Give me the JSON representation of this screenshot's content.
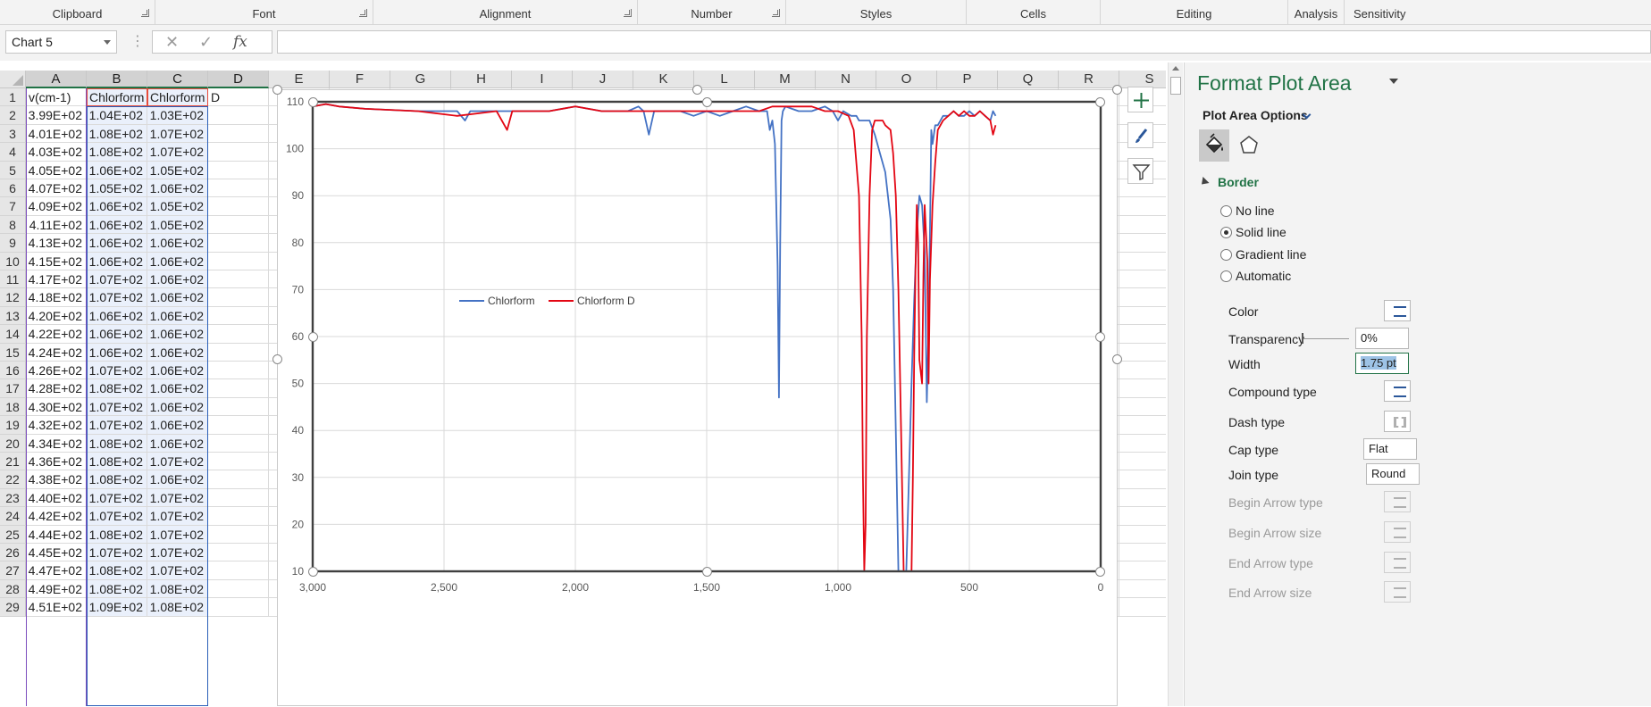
{
  "ribbon": {
    "groups": [
      "Clipboard",
      "Font",
      "Alignment",
      "Number",
      "Styles",
      "Cells",
      "Editing",
      "Analysis",
      "Sensitivity"
    ]
  },
  "formula_bar": {
    "name_box": "Chart 5",
    "cancel_icon": "✕",
    "enter_icon": "✓",
    "fx_label": "fx",
    "formula": ""
  },
  "grid": {
    "columns": [
      "A",
      "B",
      "C",
      "D",
      "E",
      "F",
      "G",
      "H",
      "I",
      "J",
      "K",
      "L",
      "M",
      "N",
      "O",
      "P",
      "Q",
      "R",
      "S"
    ],
    "rows": [
      {
        "n": "1",
        "a": "v(cm-1)",
        "b": "Chlorform",
        "c": "Chlorform",
        "d": "D"
      },
      {
        "n": "2",
        "a": "3.99E+02",
        "b": "1.04E+02",
        "c": "1.03E+02"
      },
      {
        "n": "3",
        "a": "4.01E+02",
        "b": "1.08E+02",
        "c": "1.07E+02"
      },
      {
        "n": "4",
        "a": "4.03E+02",
        "b": "1.08E+02",
        "c": "1.07E+02"
      },
      {
        "n": "5",
        "a": "4.05E+02",
        "b": "1.06E+02",
        "c": "1.05E+02"
      },
      {
        "n": "6",
        "a": "4.07E+02",
        "b": "1.05E+02",
        "c": "1.06E+02"
      },
      {
        "n": "7",
        "a": "4.09E+02",
        "b": "1.06E+02",
        "c": "1.05E+02"
      },
      {
        "n": "8",
        "a": "4.11E+02",
        "b": "1.06E+02",
        "c": "1.05E+02"
      },
      {
        "n": "9",
        "a": "4.13E+02",
        "b": "1.06E+02",
        "c": "1.06E+02"
      },
      {
        "n": "10",
        "a": "4.15E+02",
        "b": "1.06E+02",
        "c": "1.06E+02"
      },
      {
        "n": "11",
        "a": "4.17E+02",
        "b": "1.07E+02",
        "c": "1.06E+02"
      },
      {
        "n": "12",
        "a": "4.18E+02",
        "b": "1.07E+02",
        "c": "1.06E+02"
      },
      {
        "n": "13",
        "a": "4.20E+02",
        "b": "1.06E+02",
        "c": "1.06E+02"
      },
      {
        "n": "14",
        "a": "4.22E+02",
        "b": "1.06E+02",
        "c": "1.06E+02"
      },
      {
        "n": "15",
        "a": "4.24E+02",
        "b": "1.06E+02",
        "c": "1.06E+02"
      },
      {
        "n": "16",
        "a": "4.26E+02",
        "b": "1.07E+02",
        "c": "1.06E+02"
      },
      {
        "n": "17",
        "a": "4.28E+02",
        "b": "1.08E+02",
        "c": "1.06E+02"
      },
      {
        "n": "18",
        "a": "4.30E+02",
        "b": "1.07E+02",
        "c": "1.06E+02"
      },
      {
        "n": "19",
        "a": "4.32E+02",
        "b": "1.07E+02",
        "c": "1.06E+02"
      },
      {
        "n": "20",
        "a": "4.34E+02",
        "b": "1.08E+02",
        "c": "1.06E+02"
      },
      {
        "n": "21",
        "a": "4.36E+02",
        "b": "1.08E+02",
        "c": "1.07E+02"
      },
      {
        "n": "22",
        "a": "4.38E+02",
        "b": "1.08E+02",
        "c": "1.06E+02"
      },
      {
        "n": "23",
        "a": "4.40E+02",
        "b": "1.07E+02",
        "c": "1.07E+02"
      },
      {
        "n": "24",
        "a": "4.42E+02",
        "b": "1.07E+02",
        "c": "1.07E+02"
      },
      {
        "n": "25",
        "a": "4.44E+02",
        "b": "1.08E+02",
        "c": "1.07E+02"
      },
      {
        "n": "26",
        "a": "4.45E+02",
        "b": "1.07E+02",
        "c": "1.07E+02"
      },
      {
        "n": "27",
        "a": "4.47E+02",
        "b": "1.08E+02",
        "c": "1.07E+02"
      },
      {
        "n": "28",
        "a": "4.49E+02",
        "b": "1.08E+02",
        "c": "1.08E+02"
      },
      {
        "n": "29",
        "a": "4.51E+02",
        "b": "1.09E+02",
        "c": "1.08E+02"
      }
    ]
  },
  "chart_data": {
    "type": "line",
    "xlim": [
      3000,
      0
    ],
    "ylim": [
      10,
      110
    ],
    "x_ticks": [
      "3,000",
      "2,500",
      "2,000",
      "1,500",
      "1,000",
      "500",
      "0"
    ],
    "y_ticks": [
      "110",
      "100",
      "90",
      "80",
      "70",
      "60",
      "50",
      "40",
      "30",
      "20",
      "10"
    ],
    "legend_position": "center-left",
    "gridlines": true,
    "series": [
      {
        "name": "Chlorform",
        "color": "#4472c4",
        "x": [
          3000,
          2950,
          2900,
          2800,
          2600,
          2450,
          2420,
          2400,
          2300,
          2200,
          2100,
          2000,
          1900,
          1800,
          1760,
          1740,
          1720,
          1700,
          1680,
          1640,
          1600,
          1550,
          1500,
          1450,
          1400,
          1350,
          1300,
          1270,
          1260,
          1250,
          1240,
          1230,
          1225,
          1220,
          1215,
          1210,
          1200,
          1150,
          1100,
          1050,
          1020,
          1000,
          980,
          950,
          930,
          920,
          900,
          880,
          860,
          840,
          820,
          800,
          790,
          780,
          770,
          760,
          750,
          740,
          730,
          720,
          710,
          700,
          690,
          680,
          670,
          662,
          656,
          650,
          645,
          640,
          630,
          620,
          600,
          580,
          560,
          540,
          520,
          500,
          480,
          460,
          440,
          420,
          410,
          400
        ],
        "y": [
          109,
          109.5,
          109,
          108.5,
          108,
          108,
          106,
          108,
          108,
          108,
          108,
          109,
          108,
          108,
          109,
          108,
          103,
          108,
          108,
          108,
          108,
          107,
          108,
          107,
          108,
          109,
          108,
          108,
          104,
          106,
          101,
          75,
          47,
          80,
          106,
          108,
          109,
          108,
          108,
          109,
          108,
          106,
          108,
          107,
          107,
          106,
          106,
          106,
          103,
          99,
          95,
          85,
          70,
          40,
          10,
          -20,
          -20,
          10,
          30,
          50,
          68,
          82,
          90,
          88,
          78,
          46,
          60,
          82,
          104,
          101,
          105,
          105,
          107,
          107,
          108,
          107,
          107,
          108,
          107,
          108,
          107,
          106,
          108,
          107
        ]
      },
      {
        "name": "Chlorform D",
        "color": "#e30613",
        "x": [
          3000,
          2950,
          2900,
          2800,
          2600,
          2450,
          2300,
          2280,
          2260,
          2240,
          2200,
          2100,
          2000,
          1900,
          1800,
          1700,
          1600,
          1500,
          1400,
          1300,
          1250,
          1200,
          1150,
          1100,
          1050,
          1000,
          960,
          940,
          920,
          910,
          905,
          900,
          895,
          890,
          880,
          870,
          860,
          850,
          840,
          830,
          820,
          800,
          790,
          780,
          770,
          760,
          750,
          740,
          730,
          720,
          715,
          710,
          705,
          700,
          695,
          690,
          680,
          675,
          670,
          660,
          655,
          650,
          640,
          630,
          620,
          600,
          580,
          560,
          540,
          520,
          500,
          480,
          460,
          440,
          420,
          410,
          400
        ],
        "y": [
          109,
          109.5,
          109,
          108.5,
          108,
          107,
          108,
          106,
          104,
          108,
          108,
          108,
          109,
          108,
          108,
          108,
          108,
          108,
          108,
          108,
          109,
          109,
          109,
          109,
          108,
          108,
          107,
          104,
          90,
          60,
          30,
          10,
          20,
          60,
          90,
          104,
          106,
          106,
          106,
          106,
          105,
          104,
          99,
          90,
          70,
          40,
          10,
          -20,
          -20,
          10,
          30,
          56,
          74,
          88,
          80,
          55,
          50,
          73,
          88,
          76,
          50,
          72,
          88,
          97,
          104,
          106,
          107,
          108,
          107,
          108,
          107,
          107,
          108,
          107,
          106,
          103,
          105
        ]
      }
    ]
  },
  "pane": {
    "title": "Format Plot Area",
    "options_label": "Plot Area Options",
    "section": "Border",
    "radios": [
      {
        "label": "No line",
        "checked": false
      },
      {
        "label": "Solid line",
        "checked": true
      },
      {
        "label": "Gradient line",
        "checked": false
      },
      {
        "label": "Automatic",
        "checked": false
      }
    ],
    "color_label": "Color",
    "transparency_label": "Transparency",
    "transparency_value": "0%",
    "width_label": "Width",
    "width_value": "1.75 pt",
    "compound_label": "Compound type",
    "dash_label": "Dash type",
    "cap_label": "Cap type",
    "cap_value": "Flat",
    "join_label": "Join type",
    "join_value": "Round",
    "begin_arrow_type": "Begin Arrow type",
    "begin_arrow_size": "Begin Arrow size",
    "end_arrow_type": "End Arrow type",
    "end_arrow_size": "End Arrow size"
  }
}
